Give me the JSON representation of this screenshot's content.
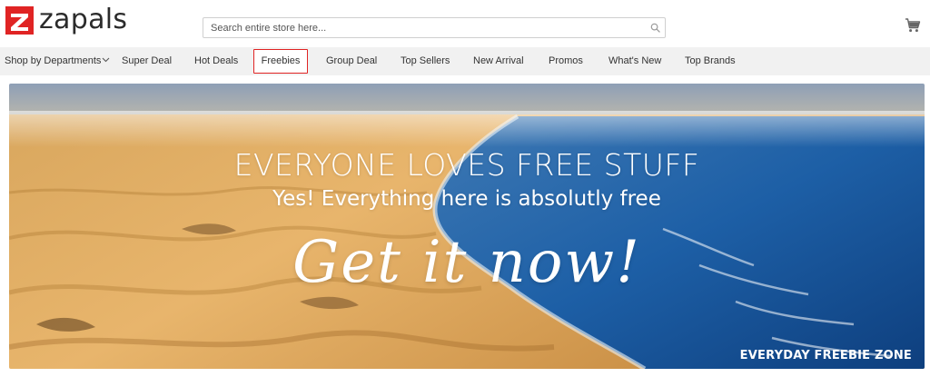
{
  "brand": {
    "name": "zapals",
    "accent_color": "#e02424"
  },
  "search": {
    "placeholder": "Search entire store here...",
    "value": "",
    "icon": "search-icon"
  },
  "cart": {
    "icon": "cart-icon"
  },
  "nav": {
    "items": [
      {
        "label": "Shop by Departments",
        "has_dropdown": true
      },
      {
        "label": "Super Deal"
      },
      {
        "label": "Hot Deals"
      },
      {
        "label": "Freebies",
        "active": true
      },
      {
        "label": "Group Deal"
      },
      {
        "label": "Top Sellers"
      },
      {
        "label": "New Arrival"
      },
      {
        "label": "Promos"
      },
      {
        "label": "What's New"
      },
      {
        "label": "Top Brands"
      }
    ]
  },
  "banner": {
    "headline": "EVERYONE LOVES FREE STUFF",
    "subline": "Yes! Everything here is absolutly free",
    "cta": "Get it now!",
    "footer": "EVERYDAY FREEBIE ZONE"
  }
}
